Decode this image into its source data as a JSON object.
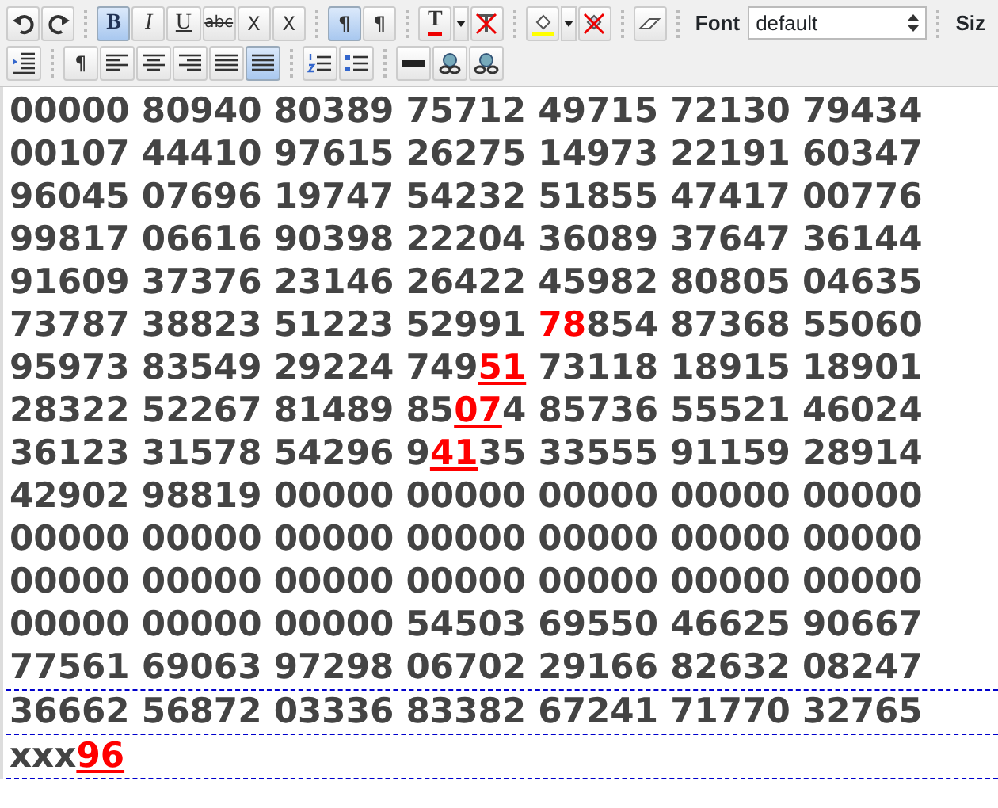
{
  "toolbar_row_1": [
    {
      "kind": "undo",
      "selected": false
    },
    {
      "kind": "redo",
      "selected": false
    },
    {
      "kind": "sep"
    },
    {
      "kind": "bold",
      "label": "B",
      "selected": true
    },
    {
      "kind": "italic",
      "label": "I",
      "selected": false
    },
    {
      "kind": "underline",
      "label": "U",
      "selected": false
    },
    {
      "kind": "strike",
      "label": "abc",
      "selected": false
    },
    {
      "kind": "subscript",
      "label": "X",
      "selected": false
    },
    {
      "kind": "superscript",
      "label": "X",
      "selected": false
    },
    {
      "kind": "sep"
    },
    {
      "kind": "ltr",
      "label": "¶",
      "selected": true
    },
    {
      "kind": "rtl",
      "label": "¶",
      "selected": false
    },
    {
      "kind": "sep"
    },
    {
      "kind": "text-color",
      "label": "T",
      "selected": false
    },
    {
      "kind": "dropdown"
    },
    {
      "kind": "remove-color",
      "selected": false
    },
    {
      "kind": "sep"
    },
    {
      "kind": "highlight",
      "selected": false
    },
    {
      "kind": "dropdown"
    },
    {
      "kind": "remove-highlight",
      "selected": false
    },
    {
      "kind": "sep"
    },
    {
      "kind": "eraser",
      "selected": false
    },
    {
      "kind": "sep"
    },
    {
      "kind": "font-label",
      "label": "Font"
    },
    {
      "kind": "font-select",
      "value": "default"
    },
    {
      "kind": "sep"
    },
    {
      "kind": "size-label",
      "label": "Siz"
    }
  ],
  "toolbar_row_2": [
    {
      "kind": "indent",
      "selected": false
    },
    {
      "kind": "sep"
    },
    {
      "kind": "para-right",
      "label": "¶",
      "selected": false
    },
    {
      "kind": "align-left",
      "selected": false
    },
    {
      "kind": "align-center",
      "selected": false
    },
    {
      "kind": "align-right",
      "selected": false
    },
    {
      "kind": "justify",
      "selected": false
    },
    {
      "kind": "justify",
      "selected": true
    },
    {
      "kind": "sep"
    },
    {
      "kind": "ordered-list",
      "selected": false
    },
    {
      "kind": "unordered-list",
      "selected": false
    },
    {
      "kind": "sep"
    },
    {
      "kind": "rule",
      "selected": false
    },
    {
      "kind": "link",
      "selected": false
    },
    {
      "kind": "unlink",
      "selected": false
    }
  ],
  "editor_lines": [
    {
      "segments": [
        {
          "text": "00000 80940 80389 75712 49715 72130 79434"
        }
      ]
    },
    {
      "segments": [
        {
          "text": "00107 44410 97615 26275 14973 22191 60347"
        }
      ]
    },
    {
      "segments": [
        {
          "text": "96045 07696 19747 54232 51855 47417 00776"
        }
      ]
    },
    {
      "segments": [
        {
          "text": "99817 06616 90398 22204 36089 37647 36144"
        }
      ]
    },
    {
      "segments": [
        {
          "text": "91609 37376 23146 26422 45982 80805 04635"
        }
      ]
    },
    {
      "segments": [
        {
          "text": "73787 38823 51223 52991 "
        },
        {
          "text": "78",
          "red": true
        },
        {
          "text": "854 87368 55060"
        }
      ]
    },
    {
      "segments": [
        {
          "text": "95973 83549 29224 749"
        },
        {
          "text": "51",
          "red": true,
          "underline": true
        },
        {
          "text": " 73118 18915 18901"
        }
      ]
    },
    {
      "segments": [
        {
          "text": "28322 52267 81489 85"
        },
        {
          "text": "07",
          "red": true,
          "underline": true
        },
        {
          "text": "4 85736 55521 46024"
        }
      ]
    },
    {
      "segments": [
        {
          "text": "36123 31578 54296 9"
        },
        {
          "text": "41",
          "red": true,
          "underline": true
        },
        {
          "text": "35 33555 91159 28914"
        }
      ]
    },
    {
      "segments": [
        {
          "text": "42902 98819 00000 00000 00000 00000 00000"
        }
      ]
    },
    {
      "segments": [
        {
          "text": "00000 00000 00000 00000 00000 00000 00000"
        }
      ]
    },
    {
      "segments": [
        {
          "text": "00000 00000 00000 00000 00000 00000 00000"
        }
      ]
    },
    {
      "segments": [
        {
          "text": "00000 00000 00000 54503 69550 46625 90667"
        }
      ]
    },
    {
      "segments": [
        {
          "text": "77561 69063 97298 06702 29166 82632 08247"
        }
      ]
    },
    {
      "boxed": true,
      "segments": [
        {
          "text": "36662 56872 03336 83382 67241 71770 32765"
        }
      ]
    },
    {
      "boxed": true,
      "segments": [
        {
          "text": "xxx"
        },
        {
          "text": "96",
          "red": true,
          "underline": true
        }
      ]
    }
  ]
}
